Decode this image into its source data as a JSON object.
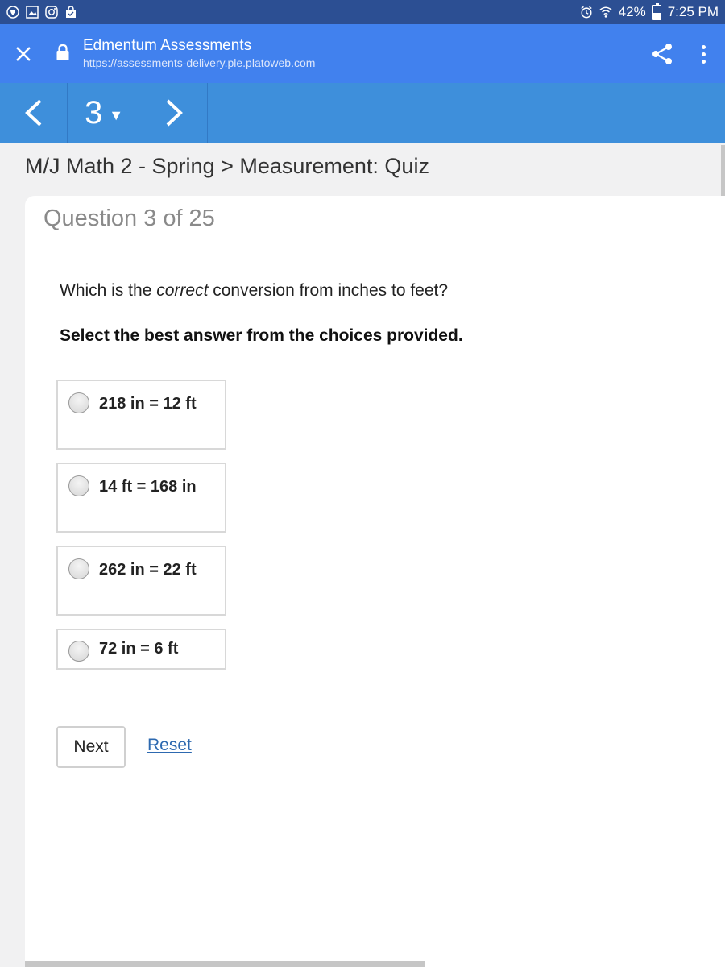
{
  "status_bar": {
    "battery_percent": "42%",
    "battery_level": 0.42,
    "time": "7:25 PM",
    "icons": [
      "vpn-shield-icon",
      "gallery-icon",
      "instagram-icon",
      "shopping-bag-icon",
      "alarm-icon",
      "wifi-icon",
      "battery-icon"
    ]
  },
  "browser": {
    "site_title": "Edmentum Assessments",
    "url": "https://assessments-delivery.ple.platoweb.com",
    "icons": [
      "close-icon",
      "lock-icon",
      "share-icon",
      "more-vert-icon"
    ]
  },
  "nav": {
    "question_number": "3",
    "caret": "▼",
    "prev_symbol": "<",
    "next_symbol": ">"
  },
  "breadcrumb": "M/J Math 2 - Spring > Measurement: Quiz",
  "question": {
    "counter": "Question 3 of 25",
    "text_before": "Which is the ",
    "text_emphasis": "correct",
    "text_after": " conversion from inches to feet?",
    "instruction": "Select the best answer from the choices provided."
  },
  "choices": [
    {
      "label": "218 in = 12 ft",
      "selected": false
    },
    {
      "label": "14 ft = 168 in",
      "selected": false
    },
    {
      "label": "262 in = 22 ft",
      "selected": false
    },
    {
      "label": "72 in = 6 ft",
      "selected": false
    }
  ],
  "actions": {
    "next_label": "Next",
    "reset_label": "Reset"
  },
  "colors": {
    "status_bar": "#2c4f93",
    "browser_bar": "#4181ee",
    "nav_bar": "#3e8fdb",
    "link": "#2d69b0"
  }
}
